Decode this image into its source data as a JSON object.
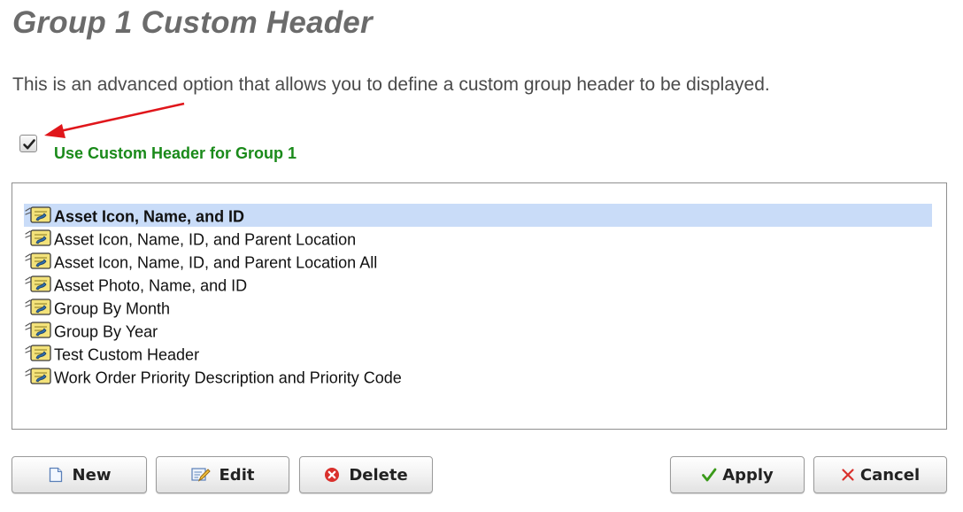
{
  "page": {
    "title": "Group 1 Custom Header",
    "description": "This is an advanced option that allows you to define a custom group header to be displayed."
  },
  "custom_header_option": {
    "checked": true,
    "label": "Use Custom Header for Group 1"
  },
  "header_list": {
    "selected_index": 0,
    "items": [
      {
        "label": "Asset Icon, Name, and ID",
        "icon": "custom-header-icon"
      },
      {
        "label": "Asset Icon, Name, ID, and Parent Location",
        "icon": "custom-header-icon"
      },
      {
        "label": "Asset Icon, Name, ID, and Parent Location All",
        "icon": "custom-header-icon"
      },
      {
        "label": "Asset Photo, Name, and ID",
        "icon": "custom-header-icon"
      },
      {
        "label": "Group By Month",
        "icon": "custom-header-icon"
      },
      {
        "label": "Group By Year",
        "icon": "custom-header-icon"
      },
      {
        "label": "Test Custom Header",
        "icon": "custom-header-icon"
      },
      {
        "label": "Work Order Priority Description and Priority Code",
        "icon": "custom-header-icon"
      }
    ]
  },
  "buttons": {
    "new": {
      "label": "New",
      "icon": "new-document-icon"
    },
    "edit": {
      "label": "Edit",
      "icon": "edit-icon"
    },
    "delete": {
      "label": "Delete",
      "icon": "delete-icon"
    },
    "apply": {
      "label": "Apply",
      "icon": "checkmark-icon"
    },
    "cancel": {
      "label": "Cancel",
      "icon": "close-icon"
    }
  },
  "colors": {
    "title": "#6b6b6b",
    "checkbox_label": "#1a8a1a",
    "selected_row": "#c9dcf8",
    "annotation_arrow": "#e0161b",
    "delete_icon": "#d9302c",
    "apply_icon": "#3a9a1a",
    "cancel_icon": "#d9302c"
  }
}
